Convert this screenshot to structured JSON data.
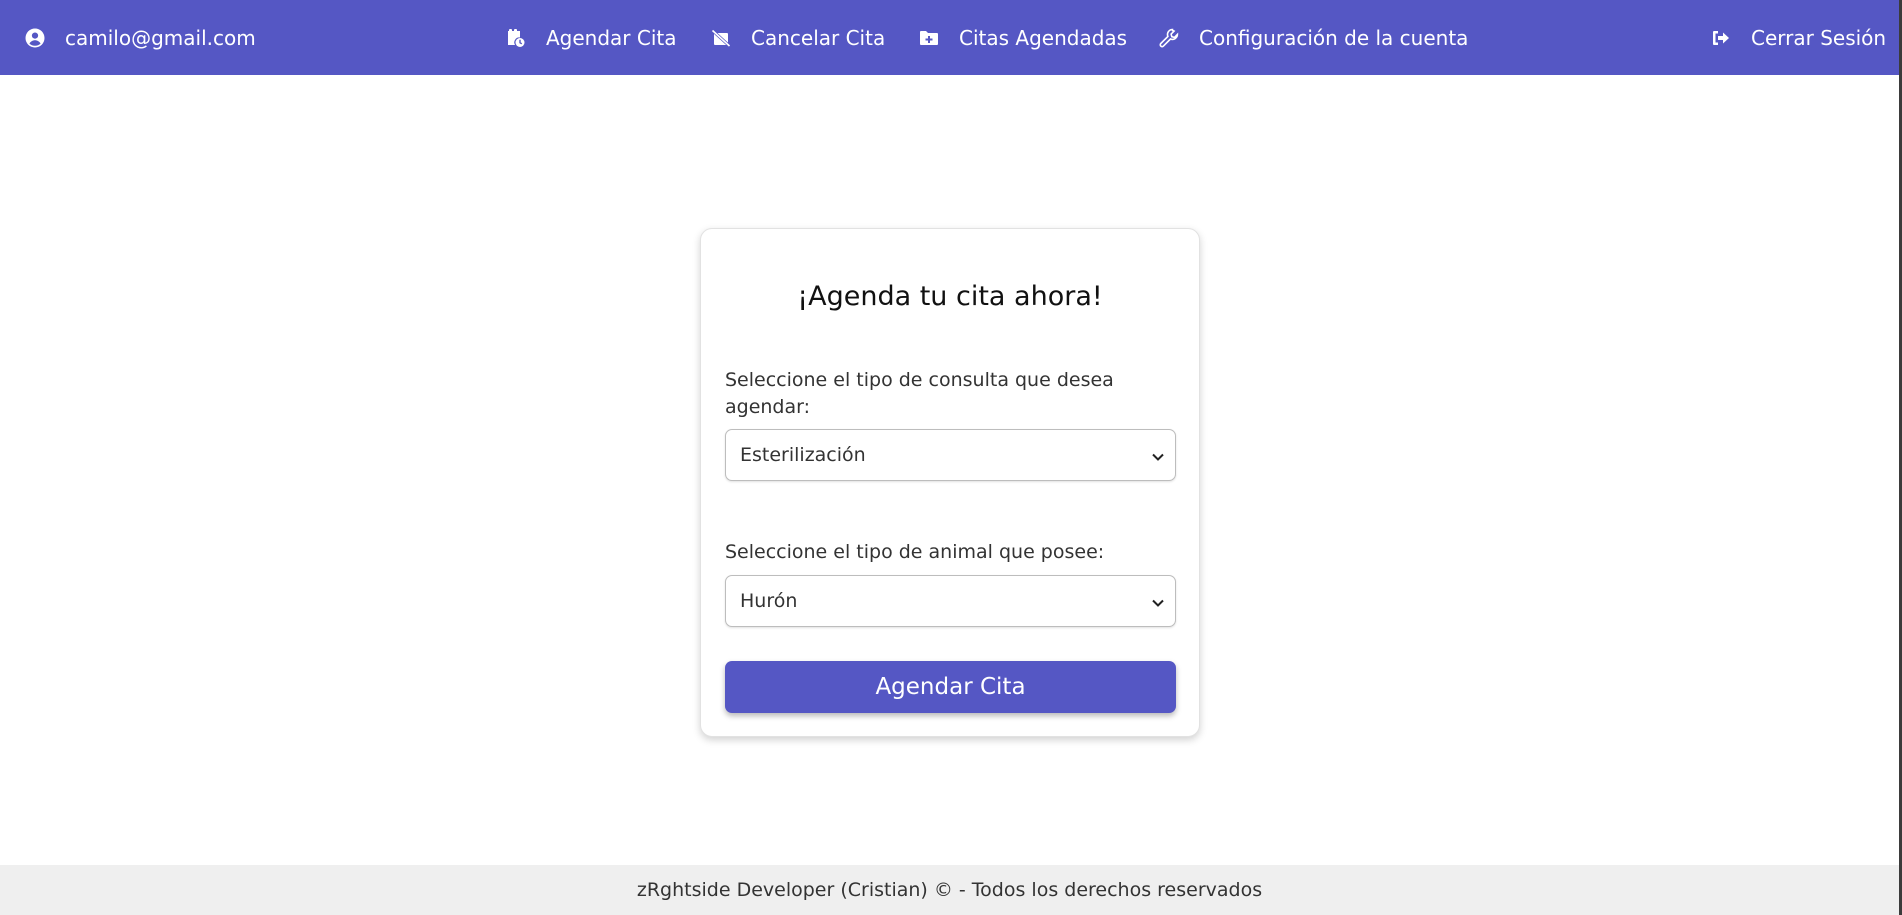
{
  "navbar": {
    "user_email": "camilo@gmail.com",
    "items": [
      {
        "label": "Agendar Cita",
        "icon": "calendar-clock-icon"
      },
      {
        "label": "Cancelar Cita",
        "icon": "calendar-slash-icon"
      },
      {
        "label": "Citas Agendadas",
        "icon": "folder-plus-icon"
      },
      {
        "label": "Configuración de la cuenta",
        "icon": "wrench-icon"
      }
    ],
    "logout_label": "Cerrar Sesión",
    "background_color": "#5557c4"
  },
  "form": {
    "title": "¡Agenda tu cita ahora!",
    "consulta_label": " Seleccione el tipo de consulta que desea agendar:",
    "consulta_value": "Esterilización",
    "animal_label": " Seleccione el tipo de animal que posee:",
    "animal_value": "Hurón",
    "submit_label": "Agendar Cita",
    "button_color": "#5557c4"
  },
  "footer": {
    "text": "zRghtside Developer (Cristian) © - Todos los derechos reservados"
  }
}
